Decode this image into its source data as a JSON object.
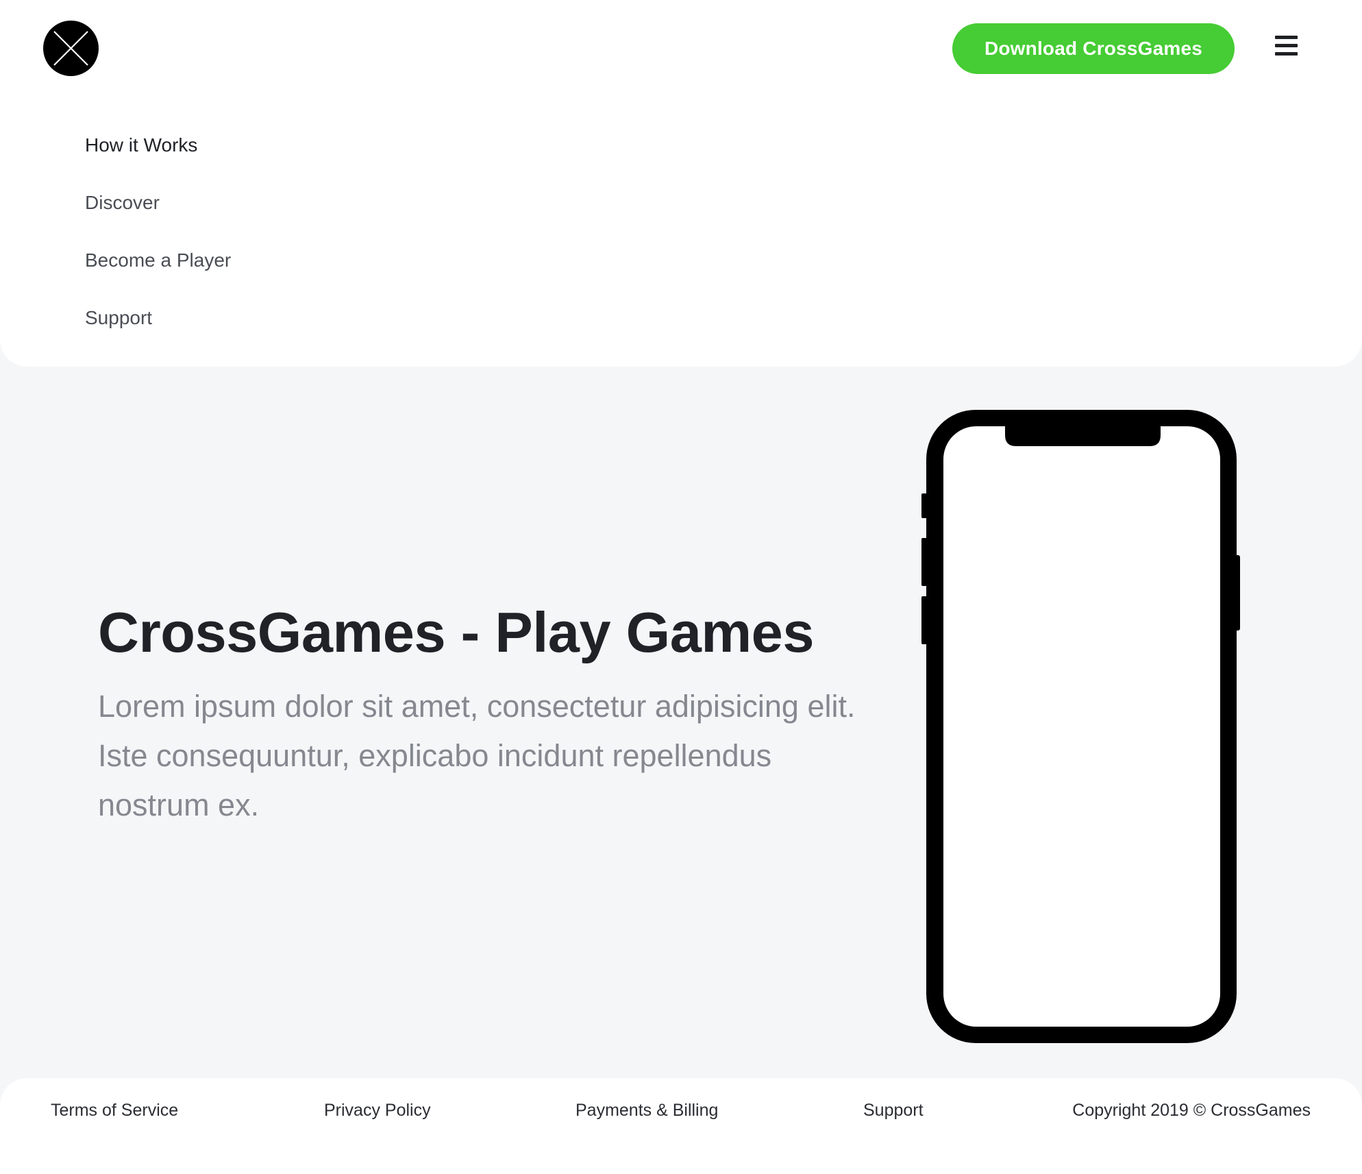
{
  "brand": {
    "logo_icon": "crossed-circle-logo-icon",
    "accent_color": "#46cc34"
  },
  "header": {
    "download_label": "Download CrossGames",
    "menu_icon": "hamburger-menu-icon"
  },
  "nav": {
    "items": [
      {
        "label": "How it Works",
        "active": true
      },
      {
        "label": "Discover",
        "active": false
      },
      {
        "label": "Become a Player",
        "active": false
      },
      {
        "label": "Support",
        "active": false
      }
    ]
  },
  "hero": {
    "title": "CrossGames - Play Games",
    "text": "Lorem ipsum dolor sit amet, consectetur adipisicing elit. Iste consequuntur, explicabo incidunt repellendus nostrum ex.",
    "device_icon": "phone-mockup-icon"
  },
  "footer": {
    "links": [
      {
        "label": "Terms of Service"
      },
      {
        "label": "Privacy Policy"
      },
      {
        "label": "Payments & Billing"
      },
      {
        "label": "Support"
      }
    ],
    "copyright": "Copyright 2019 © CrossGames"
  }
}
